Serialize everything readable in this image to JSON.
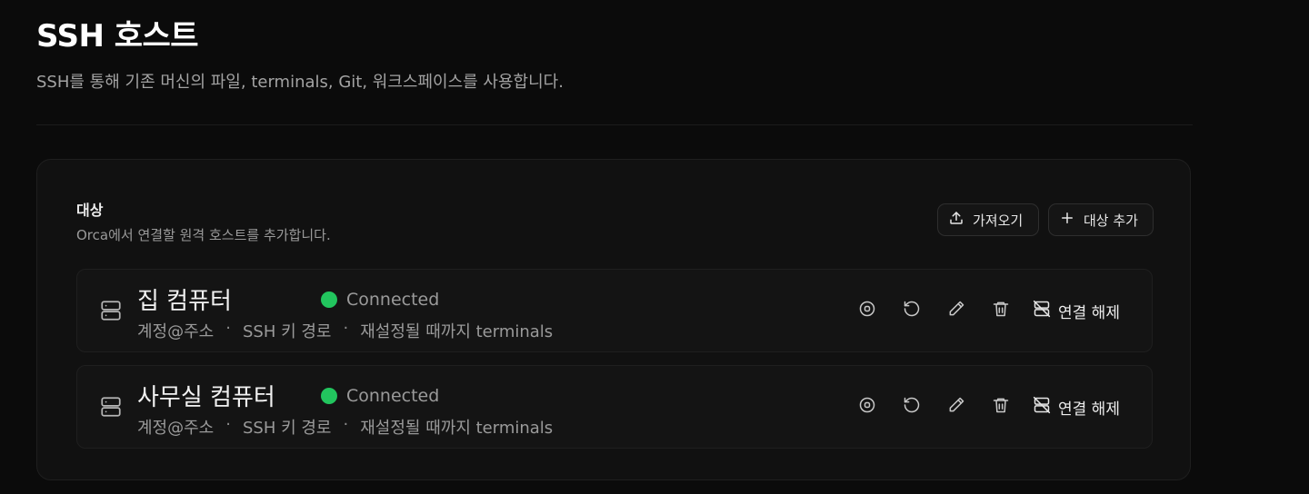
{
  "page": {
    "title": "SSH 호스트",
    "subtitle": "SSH를 통해 기존 머신의 파일, terminals, Git, 워크스페이스를 사용합니다."
  },
  "targets": {
    "title": "대상",
    "description": "Orca에서 연결할 원격 호스트를 추가합니다.",
    "import_label": "가져오기",
    "add_label": "대상 추가"
  },
  "hosts": [
    {
      "name": "집 컴퓨터",
      "status": "Connected",
      "account": "계정@주소",
      "key": "SSH 키 경로",
      "persistence": "재설정될 때까지 terminals",
      "disconnect_label": "연결 해제"
    },
    {
      "name": "사무실 컴퓨터",
      "status": "Connected",
      "account": "계정@주소",
      "key": "SSH 키 경로",
      "persistence": "재설정될 때까지 terminals",
      "disconnect_label": "연결 해제"
    }
  ],
  "separator": "·",
  "colors": {
    "background": "#0b0b0b",
    "card": "#111111",
    "status_connected": "#22c55e"
  },
  "icons": {
    "import": "upload-icon",
    "add": "plus-icon",
    "server": "server-icon",
    "stop": "stop-circle-icon",
    "restart": "rotate-ccw-icon",
    "edit": "pencil-icon",
    "delete": "trash-icon",
    "disconnect": "unplug-icon"
  }
}
